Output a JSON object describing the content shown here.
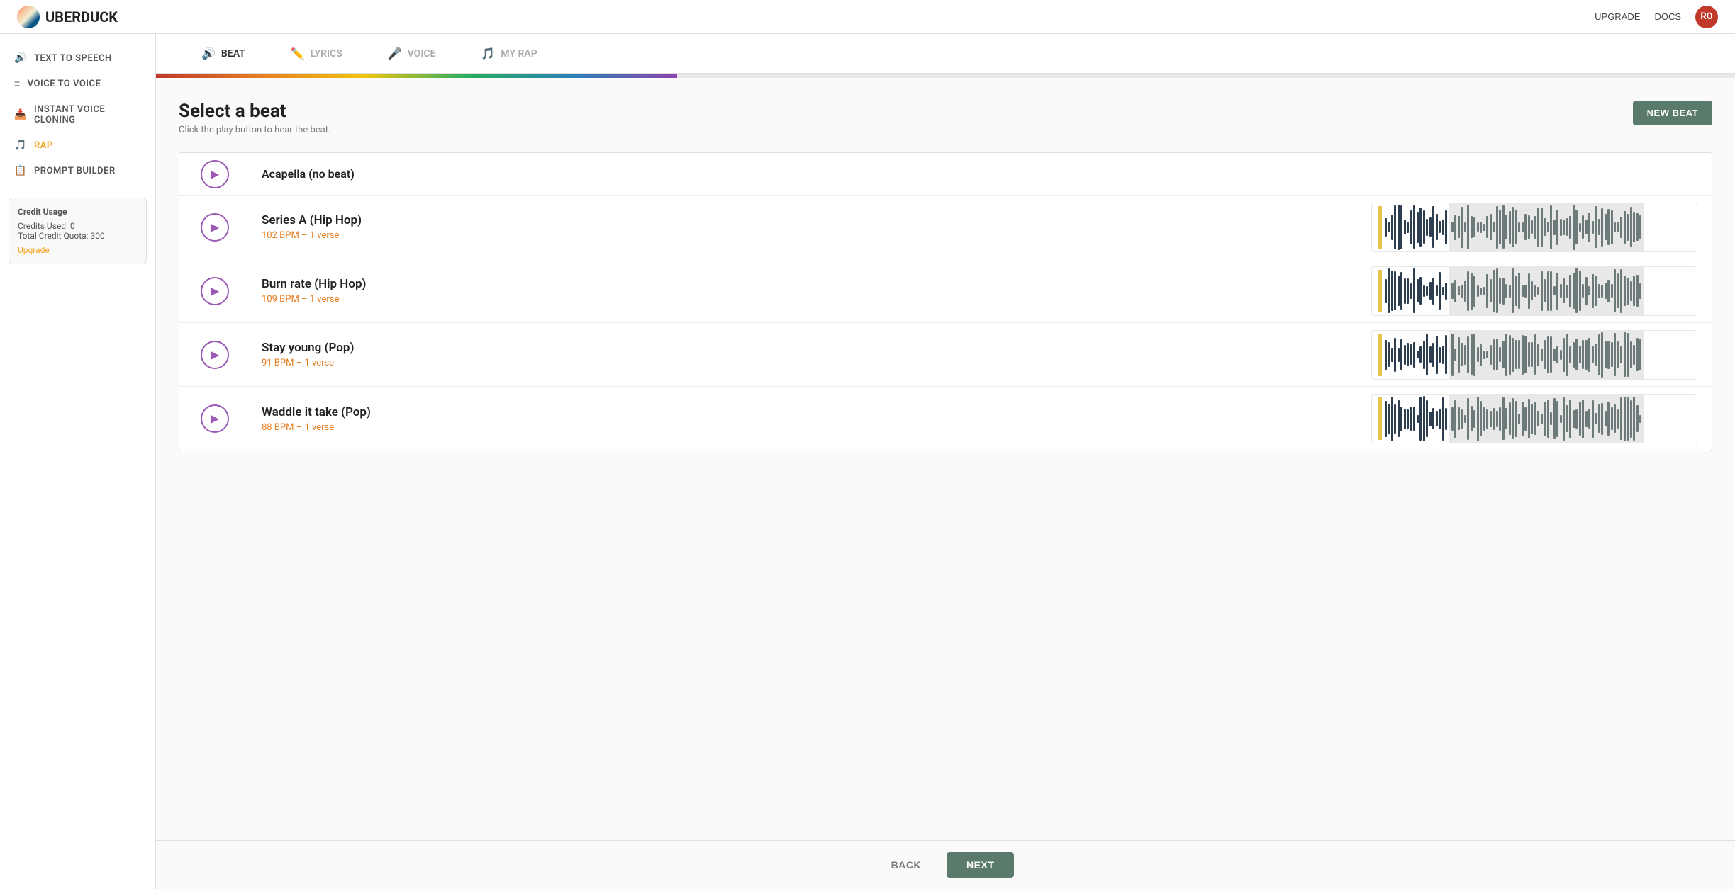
{
  "header": {
    "logo_text": "UBERDUCK",
    "upgrade_label": "UPGRADE",
    "docs_label": "DOCS",
    "avatar_initials": "RO"
  },
  "sidebar": {
    "items": [
      {
        "id": "text-to-speech",
        "label": "TEXT TO SPEECH",
        "icon": "🔊",
        "active": false
      },
      {
        "id": "voice-to-voice",
        "label": "VOICE TO VOICE",
        "icon": "≡",
        "active": false
      },
      {
        "id": "instant-voice-cloning",
        "label": "INSTANT VOICE CLONING",
        "icon": "📥",
        "active": false
      },
      {
        "id": "rap",
        "label": "RAP",
        "icon": "🎵",
        "active": true
      },
      {
        "id": "prompt-builder",
        "label": "PROMPT BUILDER",
        "icon": "📋",
        "active": false
      }
    ],
    "credit_usage": {
      "title": "Credit Usage",
      "credits_used_label": "Credits Used: 0",
      "total_quota_label": "Total Credit Quota: 300",
      "upgrade_label": "Upgrade"
    }
  },
  "steps": [
    {
      "id": "beat",
      "label": "BEAT",
      "icon": "🔊",
      "active": true
    },
    {
      "id": "lyrics",
      "label": "LYRICS",
      "icon": "✏️",
      "active": false
    },
    {
      "id": "voice",
      "label": "VOICE",
      "icon": "🎤",
      "active": false
    },
    {
      "id": "my-rap",
      "label": "MY RAP",
      "icon": "🎵",
      "active": false
    }
  ],
  "progress_percent": 33,
  "content": {
    "title": "Select a beat",
    "subtitle": "Click the play button to hear the beat.",
    "new_beat_label": "NEW BEAT"
  },
  "beats": [
    {
      "id": "acapella",
      "name": "Acapella (no beat)",
      "bpm": null,
      "verse": null,
      "acapella": true
    },
    {
      "id": "series-a",
      "name": "Series A (Hip Hop)",
      "bpm": "102 BPM",
      "verse": "1 verse",
      "acapella": false
    },
    {
      "id": "burn-rate",
      "name": "Burn rate (Hip Hop)",
      "bpm": "109 BPM",
      "verse": "1 verse",
      "acapella": false
    },
    {
      "id": "stay-young",
      "name": "Stay young (Pop)",
      "bpm": "91 BPM",
      "verse": "1 verse",
      "acapella": false
    },
    {
      "id": "waddle-it-take",
      "name": "Waddle it take (Pop)",
      "bpm": "88 BPM",
      "verse": "1 verse",
      "acapella": false
    }
  ],
  "bottom": {
    "back_label": "BACK",
    "next_label": "NEXT"
  }
}
